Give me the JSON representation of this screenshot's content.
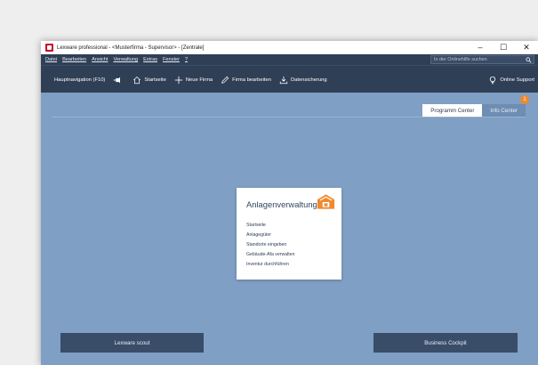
{
  "window": {
    "title": "Lexware professional - <Musterfirma - Supervisor> - [Zentrale]",
    "controls": {
      "minimize": "–",
      "maximize": "☐",
      "close": "✕"
    }
  },
  "menubar": {
    "items": [
      "Datei",
      "Bearbeiten",
      "Ansicht",
      "Verwaltung",
      "Extras",
      "Fenster",
      "?"
    ],
    "search_placeholder": "In der Onlinehilfe suchen"
  },
  "toolbar": {
    "items": [
      {
        "label": "Hauptnavigation (F10)",
        "icon": "none"
      },
      {
        "label": "",
        "icon": "pin-icon"
      },
      {
        "label": "Startseite",
        "icon": "home-icon"
      },
      {
        "label": "Neue Firma",
        "icon": "plus-icon"
      },
      {
        "label": "Firma bearbeiten",
        "icon": "pencil-icon"
      },
      {
        "label": "Datensicherung",
        "icon": "download-icon"
      }
    ],
    "support_label": "Online Support"
  },
  "tabs": {
    "active": "Programm Center",
    "inactive": "Info Center",
    "badge_count": "1"
  },
  "module": {
    "title": "Anlagenverwaltung",
    "links": [
      "Startseite",
      "Anlagegüter",
      "Standorte eingeben",
      "Gebäude-Afa verwalten",
      "Inventur durchführen"
    ]
  },
  "buttons": {
    "left": "Lexware scout",
    "right": "Business Cockpit"
  },
  "colors": {
    "background": "#7f9fc4",
    "toolbar": "#2f3f56",
    "accent": "#f0892d",
    "button": "#394d69"
  }
}
